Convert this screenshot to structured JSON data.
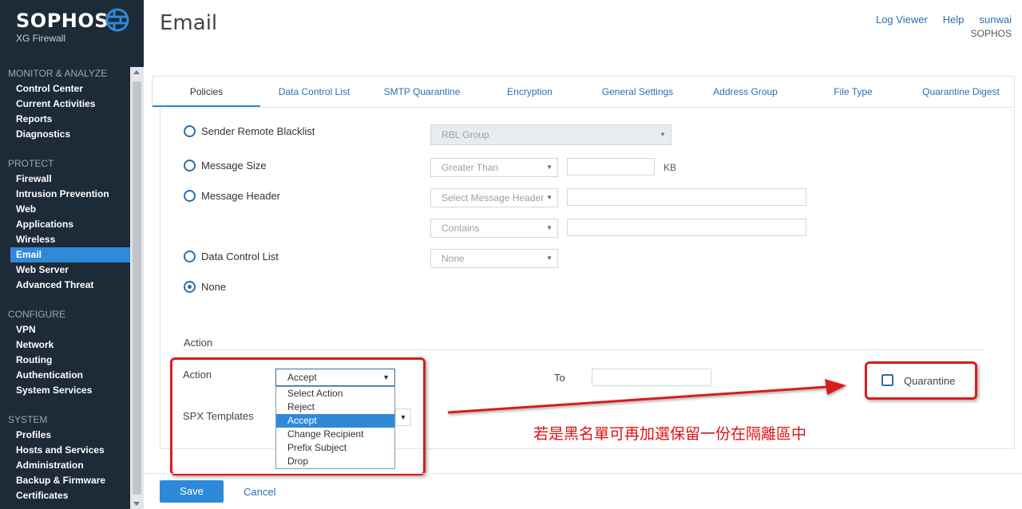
{
  "brand": {
    "name": "SOPHOS",
    "product": "XG Firewall"
  },
  "header": {
    "title": "Email",
    "links": {
      "log_viewer": "Log Viewer",
      "help": "Help",
      "user": "sunwai"
    },
    "org": "SOPHOS"
  },
  "nav": {
    "sections": [
      {
        "title": "MONITOR & ANALYZE",
        "items": [
          "Control Center",
          "Current Activities",
          "Reports",
          "Diagnostics"
        ]
      },
      {
        "title": "PROTECT",
        "items": [
          "Firewall",
          "Intrusion Prevention",
          "Web",
          "Applications",
          "Wireless",
          "Email",
          "Web Server",
          "Advanced Threat"
        ]
      },
      {
        "title": "CONFIGURE",
        "items": [
          "VPN",
          "Network",
          "Routing",
          "Authentication",
          "System Services"
        ]
      },
      {
        "title": "SYSTEM",
        "items": [
          "Profiles",
          "Hosts and Services",
          "Administration",
          "Backup & Firmware",
          "Certificates"
        ]
      }
    ],
    "active_item": "Email"
  },
  "tabs": [
    "Policies",
    "Data Control List",
    "SMTP Quarantine",
    "Encryption",
    "General Settings",
    "Address Group",
    "File Type",
    "Quarantine Digest"
  ],
  "active_tab": "Policies",
  "criteria": {
    "sender_remote_blacklist": {
      "label": "Sender Remote Blacklist",
      "select": "RBL Group"
    },
    "message_size": {
      "label": "Message Size",
      "select": "Greater Than",
      "value": "",
      "unit": "KB"
    },
    "message_header": {
      "label": "Message Header",
      "select": "Select Message Header",
      "value": "",
      "match_select": "Contains",
      "match_value": ""
    },
    "data_control_list": {
      "label": "Data Control List",
      "select": "None"
    },
    "none": {
      "label": "None",
      "checked": true
    }
  },
  "action_section": {
    "title": "Action",
    "action_label": "Action",
    "action_value": "Accept",
    "action_options": [
      "Select Action",
      "Reject",
      "Accept",
      "Change Recipient",
      "Prefix Subject",
      "Drop"
    ],
    "highlighted_option": "Accept",
    "to_label": "To",
    "to_value": "",
    "spx_label": "SPX Templates",
    "quarantine_label": "Quarantine",
    "quarantine_checked": false
  },
  "annotation": {
    "note": "若是黑名單可再加選保留一份在隔離區中",
    "color": "#e01010"
  },
  "footer": {
    "save": "Save",
    "cancel": "Cancel"
  },
  "colors": {
    "sidebar": "#1d2a38",
    "accent": "#2e8ad8",
    "link": "#2a6fb5",
    "annotation": "#d91e1e"
  },
  "icons": [
    "globe-logo-icon",
    "chevron-down-icon",
    "scroll-up-icon",
    "scroll-down-icon",
    "red-arrow-icon"
  ]
}
